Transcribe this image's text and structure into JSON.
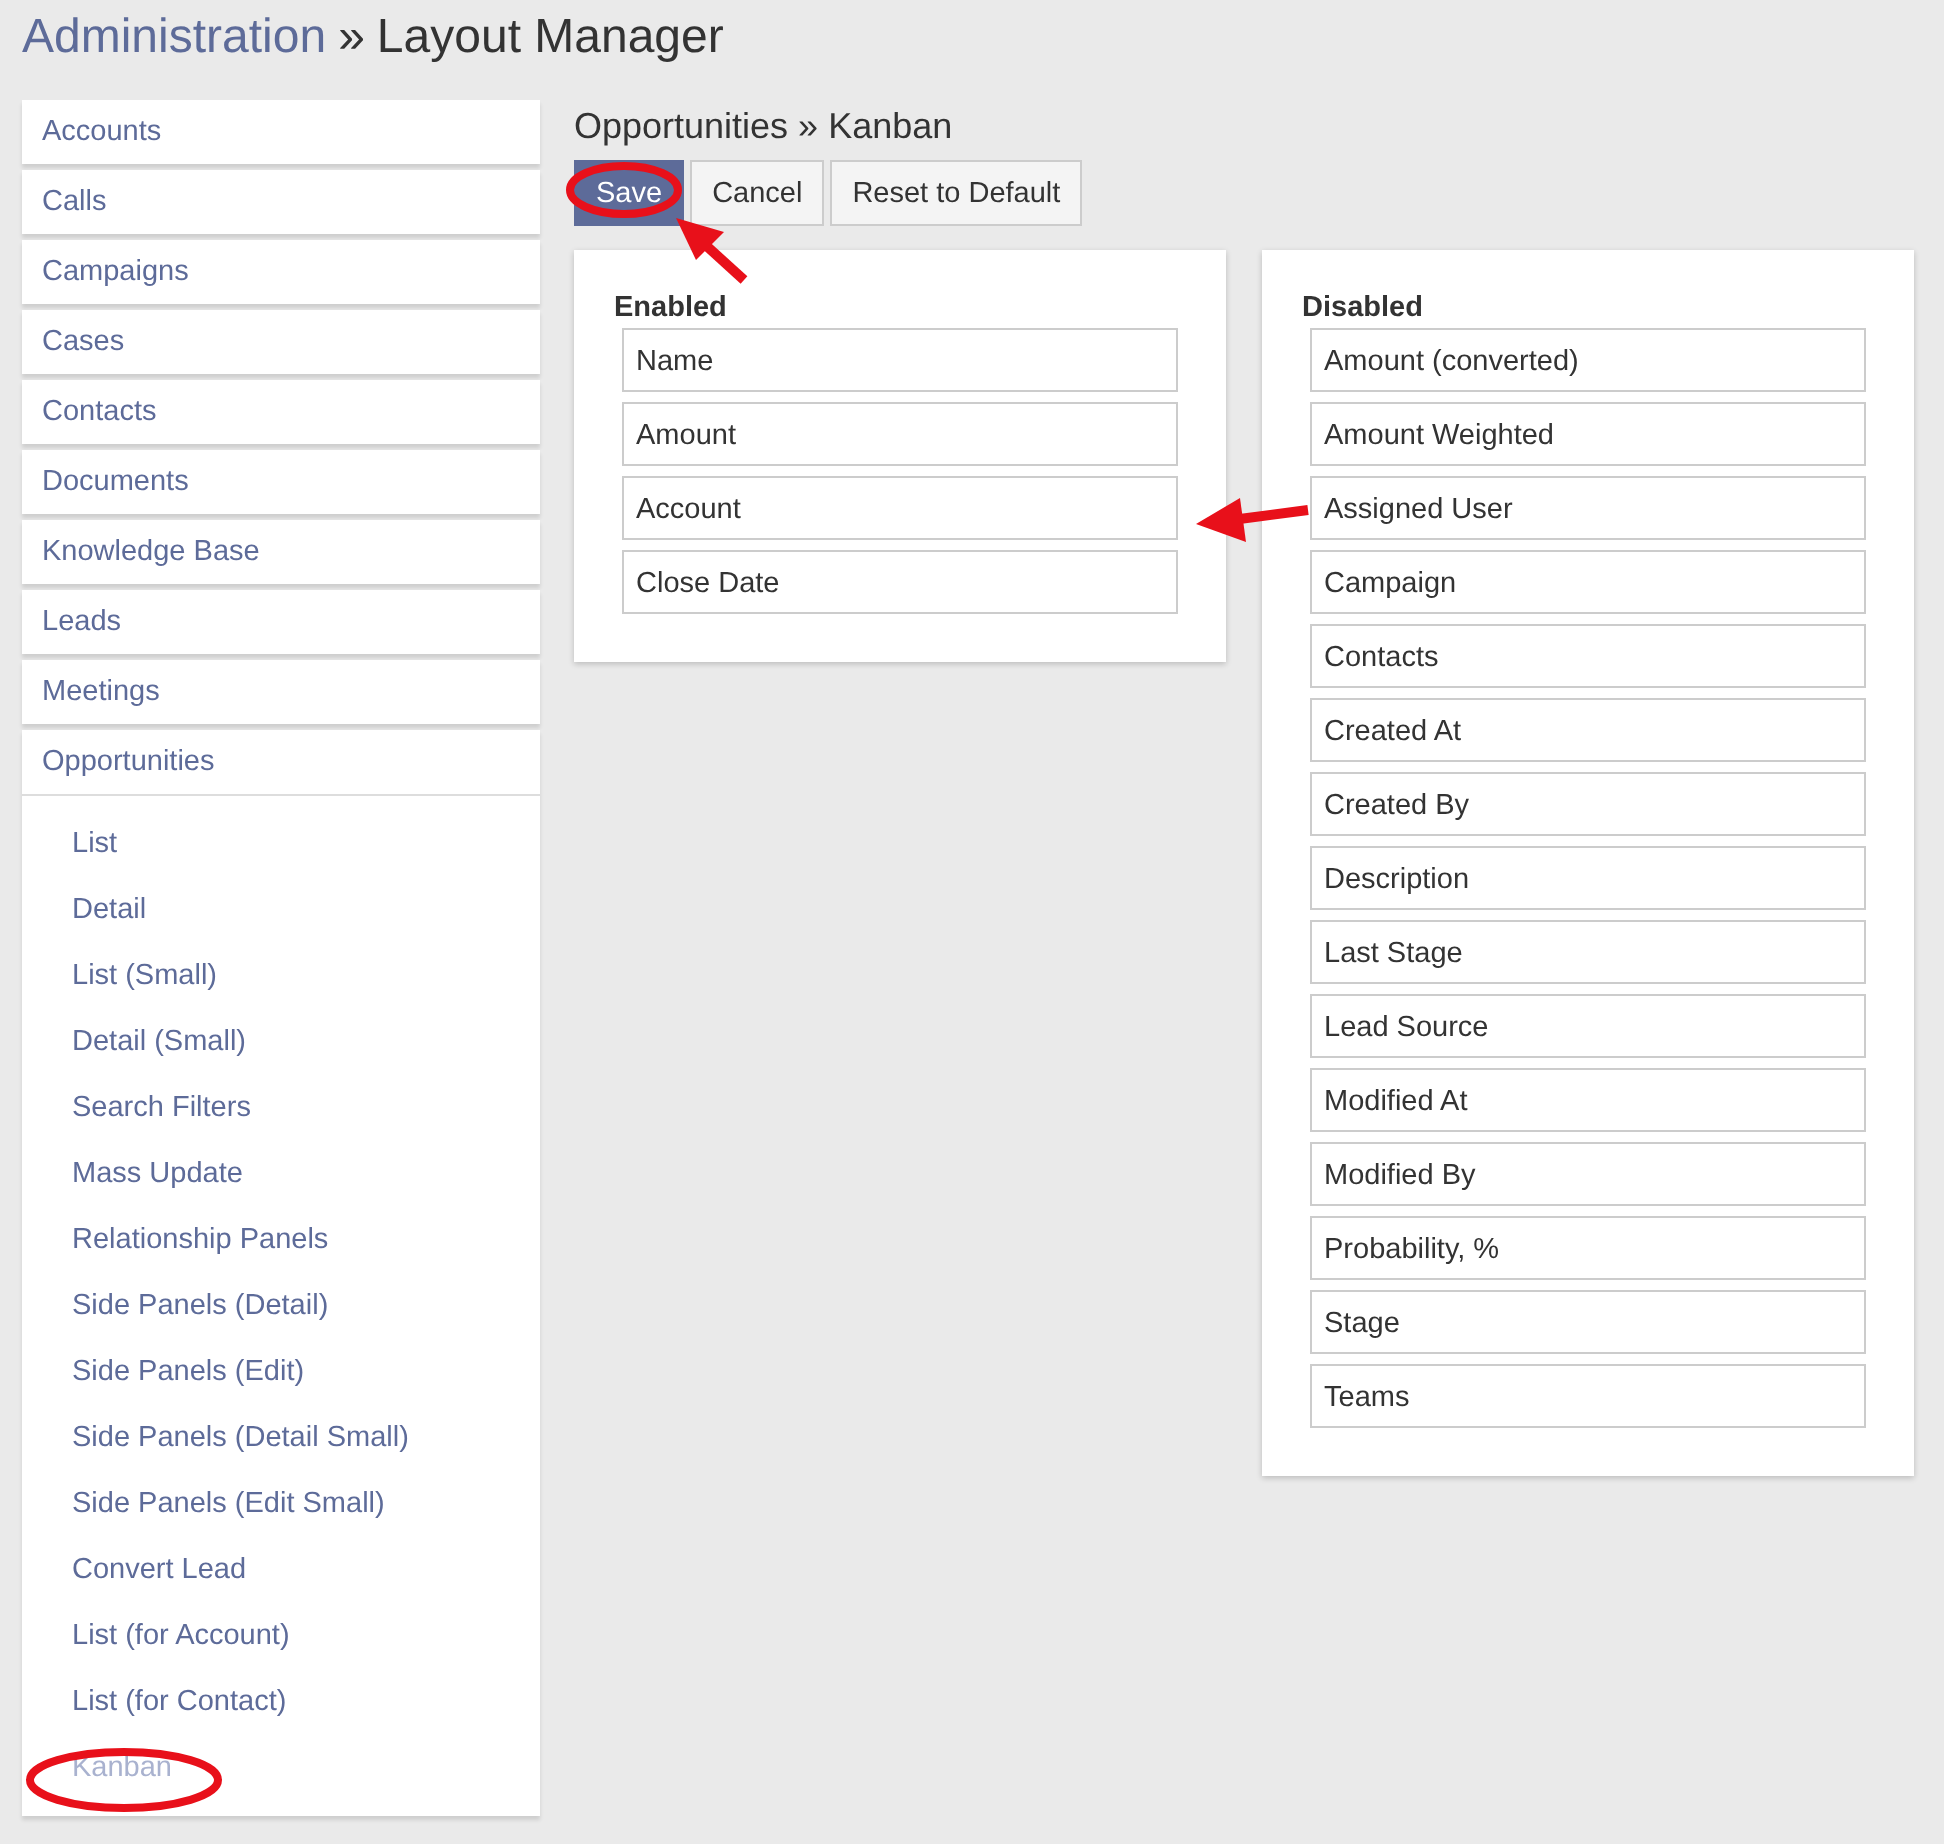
{
  "page_title": {
    "section": "Administration",
    "separator": "»",
    "page": "Layout Manager"
  },
  "sidebar": {
    "items": [
      {
        "label": "Accounts",
        "expanded": false
      },
      {
        "label": "Calls",
        "expanded": false
      },
      {
        "label": "Campaigns",
        "expanded": false
      },
      {
        "label": "Cases",
        "expanded": false
      },
      {
        "label": "Contacts",
        "expanded": false
      },
      {
        "label": "Documents",
        "expanded": false
      },
      {
        "label": "Knowledge Base",
        "expanded": false
      },
      {
        "label": "Leads",
        "expanded": false
      },
      {
        "label": "Meetings",
        "expanded": false
      },
      {
        "label": "Opportunities",
        "expanded": true,
        "children": [
          {
            "label": "List",
            "selected": false
          },
          {
            "label": "Detail",
            "selected": false
          },
          {
            "label": "List (Small)",
            "selected": false
          },
          {
            "label": "Detail (Small)",
            "selected": false
          },
          {
            "label": "Search Filters",
            "selected": false
          },
          {
            "label": "Mass Update",
            "selected": false
          },
          {
            "label": "Relationship Panels",
            "selected": false
          },
          {
            "label": "Side Panels (Detail)",
            "selected": false
          },
          {
            "label": "Side Panels (Edit)",
            "selected": false
          },
          {
            "label": "Side Panels (Detail Small)",
            "selected": false
          },
          {
            "label": "Side Panels (Edit Small)",
            "selected": false
          },
          {
            "label": "Convert Lead",
            "selected": false
          },
          {
            "label": "List (for Account)",
            "selected": false
          },
          {
            "label": "List (for Contact)",
            "selected": false
          },
          {
            "label": "Kanban",
            "selected": true
          }
        ]
      }
    ]
  },
  "heading": "Opportunities » Kanban",
  "buttons": [
    {
      "label": "Save",
      "kind": "primary"
    },
    {
      "label": "Cancel",
      "kind": "default"
    },
    {
      "label": "Reset to Default",
      "kind": "default"
    }
  ],
  "enabled": {
    "title": "Enabled",
    "fields": [
      "Name",
      "Amount",
      "Account",
      "Close Date"
    ]
  },
  "disabled": {
    "title": "Disabled",
    "fields": [
      "Amount (converted)",
      "Amount Weighted",
      "Assigned User",
      "Campaign",
      "Contacts",
      "Created At",
      "Created By",
      "Description",
      "Last Stage",
      "Lead Source",
      "Modified At",
      "Modified By",
      "Probability, %",
      "Stage",
      "Teams"
    ]
  }
}
